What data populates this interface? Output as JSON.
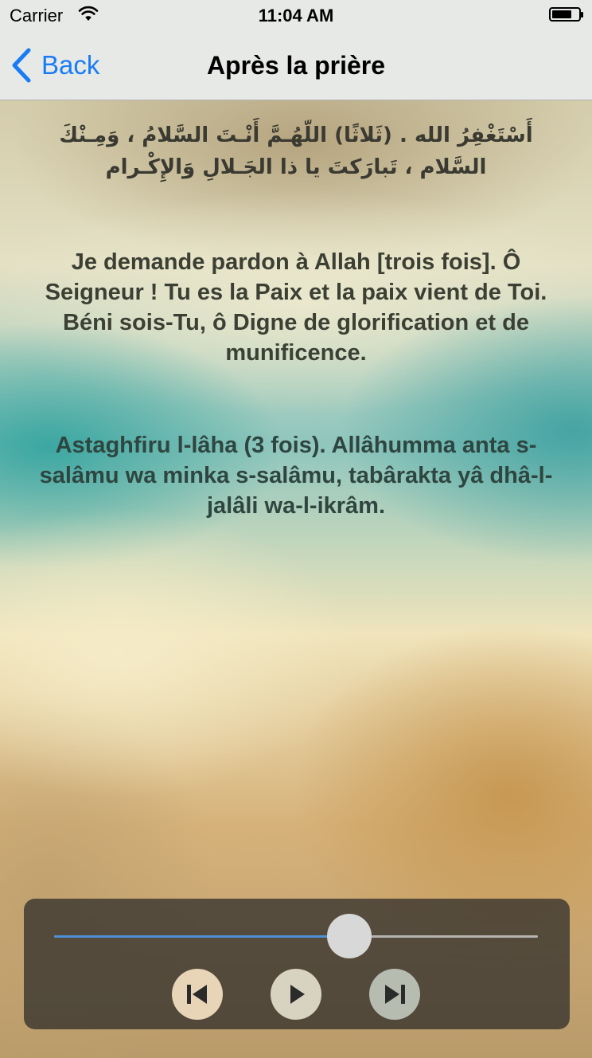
{
  "status_bar": {
    "carrier": "Carrier",
    "time": "11:04 AM",
    "wifi_icon": "wifi-icon",
    "battery_icon": "battery-icon",
    "battery_level": 0.75
  },
  "nav": {
    "back_label": "Back",
    "back_icon": "chevron-left-icon",
    "title": "Après la prière"
  },
  "content": {
    "arabic": "أَسْتَغْفِرُ الله . (ثَلاثًا) اللّهُـمَّ أَنْـتَ السَّلامُ ، وَمِـنْكَ السَّلام ، تَبارَكتَ يا ذا الجَـلالِ وَالإِكْـرام",
    "french": "Je demande pardon à Allah [trois fois]. Ô Seigneur ! Tu es la Paix et la paix vient de Toi. Béni sois-Tu, ô Digne de glorification et de munificence.",
    "transliteration": "Astaghfiru l-lâha (3 fois). Allâhumma anta s-salâmu wa minka s-salâmu, tabârakta yâ dhâ-l-jalâli wa-l-ikrâm."
  },
  "player": {
    "progress": 0.61,
    "accent_color": "#4f8fd6",
    "controls": {
      "previous_icon": "skip-previous-icon",
      "play_icon": "play-icon",
      "next_icon": "skip-next-icon"
    }
  }
}
